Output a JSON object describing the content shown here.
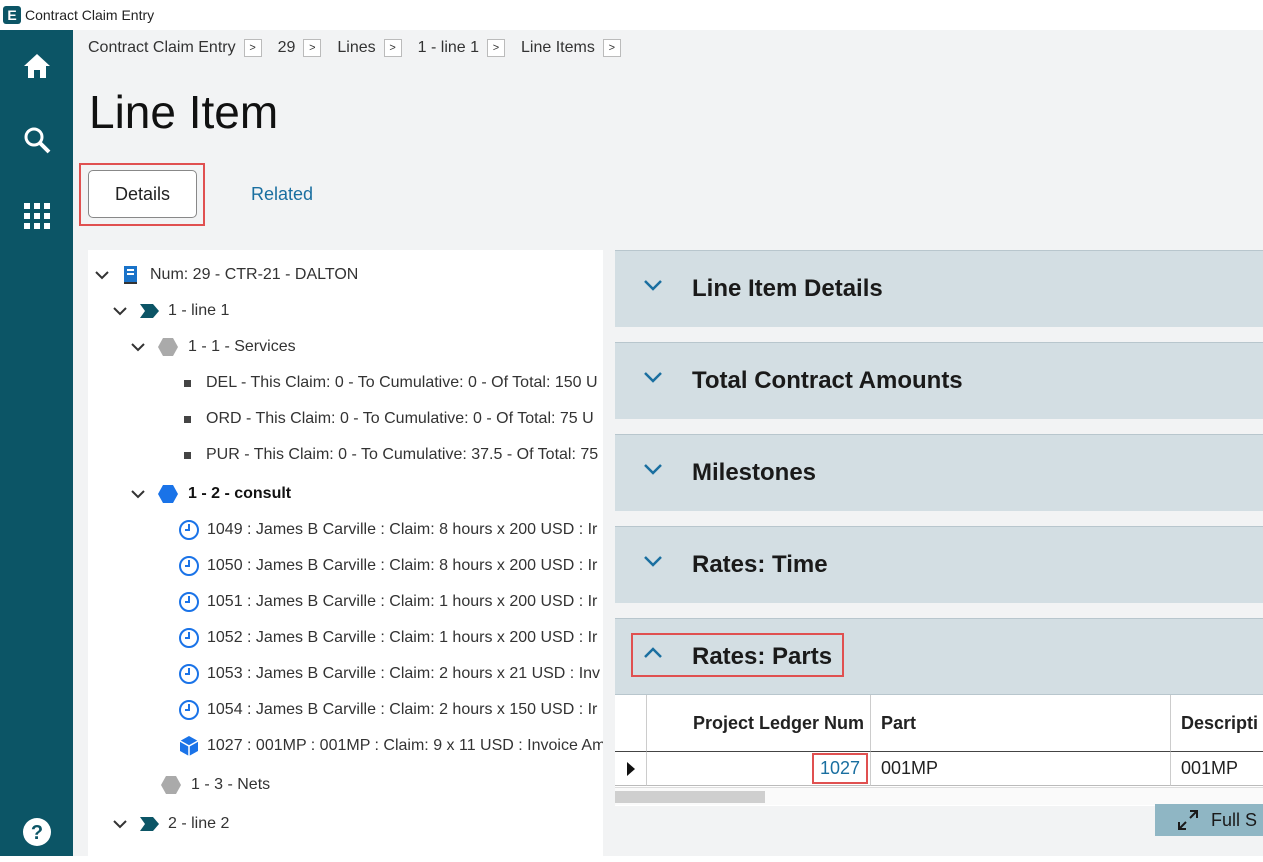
{
  "app": {
    "logo_letter": "E",
    "title": "Contract Claim Entry"
  },
  "breadcrumb": [
    {
      "label": "Contract Claim Entry"
    },
    {
      "label": "29"
    },
    {
      "label": "Lines"
    },
    {
      "label": "1 - line 1"
    },
    {
      "label": "Line Items"
    }
  ],
  "breadcrumb_sep": ">",
  "page": {
    "title": "Line Item"
  },
  "tabs": {
    "details": "Details",
    "related": "Related"
  },
  "tree": {
    "root": "Num: 29 - CTR-21 - DALTON",
    "line1": "1 - line 1",
    "services": "1 - 1 - Services",
    "svc_items": [
      "DEL - This Claim: 0 - To Cumulative: 0 - Of Total: 150 U",
      "ORD - This Claim: 0 - To Cumulative: 0 - Of Total: 75 U",
      "PUR - This Claim: 0 - To Cumulative: 37.5 - Of Total: 75"
    ],
    "consult": "1 - 2 - consult",
    "consult_items": [
      "1049 : James B Carville : Claim: 8 hours x 200 USD : Ir",
      "1050 : James B Carville : Claim: 8 hours x 200 USD : Ir",
      "1051 : James B Carville : Claim: 1 hours x 200 USD : Ir",
      "1052 : James B Carville : Claim: 1 hours x 200 USD : Ir",
      "1053 : James B Carville : Claim: 2 hours x 21 USD : Inv",
      "1054 : James B Carville : Claim: 2 hours x 150 USD : Ir"
    ],
    "part_item": "1027 : 001MP : 001MP : Claim: 9 x 11 USD : Invoice Am",
    "nets": "1 - 3 - Nets",
    "line2": "2 - line 2"
  },
  "panels": [
    {
      "title": "Line Item Details"
    },
    {
      "title": "Total Contract Amounts"
    },
    {
      "title": "Milestones"
    },
    {
      "title": "Rates: Time"
    },
    {
      "title": "Rates: Parts"
    }
  ],
  "grid": {
    "headers": {
      "ledger": "Project Ledger Num",
      "part": "Part",
      "desc": "Descripti"
    },
    "row": {
      "ledger": "1027",
      "part": "001MP",
      "desc": "001MP"
    }
  },
  "fullscreen": {
    "label": "Full S"
  },
  "colors": {
    "sidebar": "#0c5566",
    "accent": "#1a6fa0",
    "highlight": "#e05050",
    "panel": "#d3dee3"
  }
}
